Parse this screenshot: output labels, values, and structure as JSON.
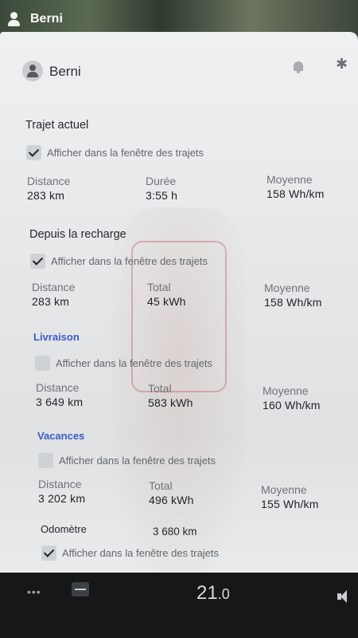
{
  "topbar": {
    "user_name": "Berni"
  },
  "header": {
    "user_name": "Berni",
    "icons": [
      "bell-icon",
      "bluetooth-icon"
    ]
  },
  "checkbox_label": "Afficher dans la fenêtre des trajets",
  "sections": [
    {
      "title": "Trajet actuel",
      "checked": true,
      "stats": [
        {
          "label": "Distance",
          "value": "283 km"
        },
        {
          "label": "Durée",
          "value": "3:55 h"
        },
        {
          "label": "Moyenne",
          "value": "158 Wh/km"
        }
      ]
    },
    {
      "title": "Depuis la recharge",
      "checked": true,
      "stats": [
        {
          "label": "Distance",
          "value": "283 km"
        },
        {
          "label": "Total",
          "value": "45 kWh"
        },
        {
          "label": "Moyenne",
          "value": "158 Wh/km"
        }
      ]
    },
    {
      "title": "Livraison",
      "checked": false,
      "stats": [
        {
          "label": "Distance",
          "value": "3 649 km"
        },
        {
          "label": "Total",
          "value": "583 kWh"
        },
        {
          "label": "Moyenne",
          "value": "160 Wh/km"
        }
      ]
    },
    {
      "title": "Vacances",
      "checked": false,
      "stats": [
        {
          "label": "Distance",
          "value": "3 202 km"
        },
        {
          "label": "Total",
          "value": "496 kWh"
        },
        {
          "label": "Moyenne",
          "value": "155 Wh/km"
        }
      ]
    }
  ],
  "odometer": {
    "label": "Odomètre",
    "value": "3 680 km",
    "checked": true
  },
  "dock": {
    "temp_main": "21",
    "temp_decimal": ".0"
  },
  "colors": {
    "accent_blue": "#3a5cc8",
    "panel_bg": "#e9ebed",
    "dock_bg": "#151719"
  }
}
